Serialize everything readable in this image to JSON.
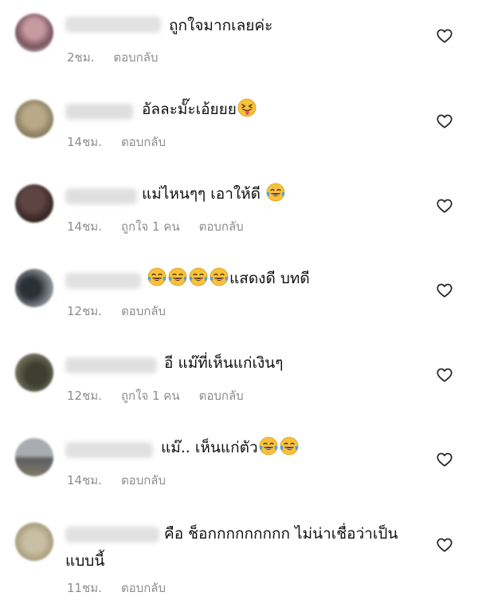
{
  "comments": [
    {
      "text": "ถูกใจมากเลยค่ะ",
      "time": "2ชม.",
      "likes": "",
      "reply": "ตอบกลับ",
      "avatar_color": "#8a6b74"
    },
    {
      "text": "อัลละมั๊ะเอ้ยยย",
      "time": "14ชม.",
      "likes": "",
      "reply": "ตอบกลับ",
      "avatar_color": "#9b8f70"
    },
    {
      "text": "แม่ไหนๆๆ เอาให้ดี",
      "time": "14ชม.",
      "likes": "ถูกใจ 1 คน",
      "reply": "ตอบกลับ",
      "avatar_color": "#3a2b2a"
    },
    {
      "text": "แสดงดี บทดี",
      "time": "12ชม.",
      "likes": "",
      "reply": "ตอบกลับ",
      "avatar_color": "#4c5158"
    },
    {
      "text": "อี แม๊ที่เห็นแก่เงินๆ",
      "time": "12ชม.",
      "likes": "ถูกใจ 1 คน",
      "reply": "ตอบกลับ",
      "avatar_color": "#5b5a46"
    },
    {
      "text": "แม๊.. เห็นแก่ตัว",
      "time": "14ชม.",
      "likes": "",
      "reply": "ตอบกลับ",
      "avatar_color": "#6d6f70"
    },
    {
      "text": "คือ ช็อกกกกกกกกก ไม่น่าเชื่อว่าเป็น",
      "text2": "แบบนี้",
      "time": "11ชม.",
      "likes": "",
      "reply": "ตอบกลับ",
      "avatar_color": "#b1a58a"
    }
  ],
  "icons": {
    "like": "heart-outline-icon",
    "laugh": "tears-of-joy-emoji",
    "tongue": "winking-tongue-emoji"
  }
}
